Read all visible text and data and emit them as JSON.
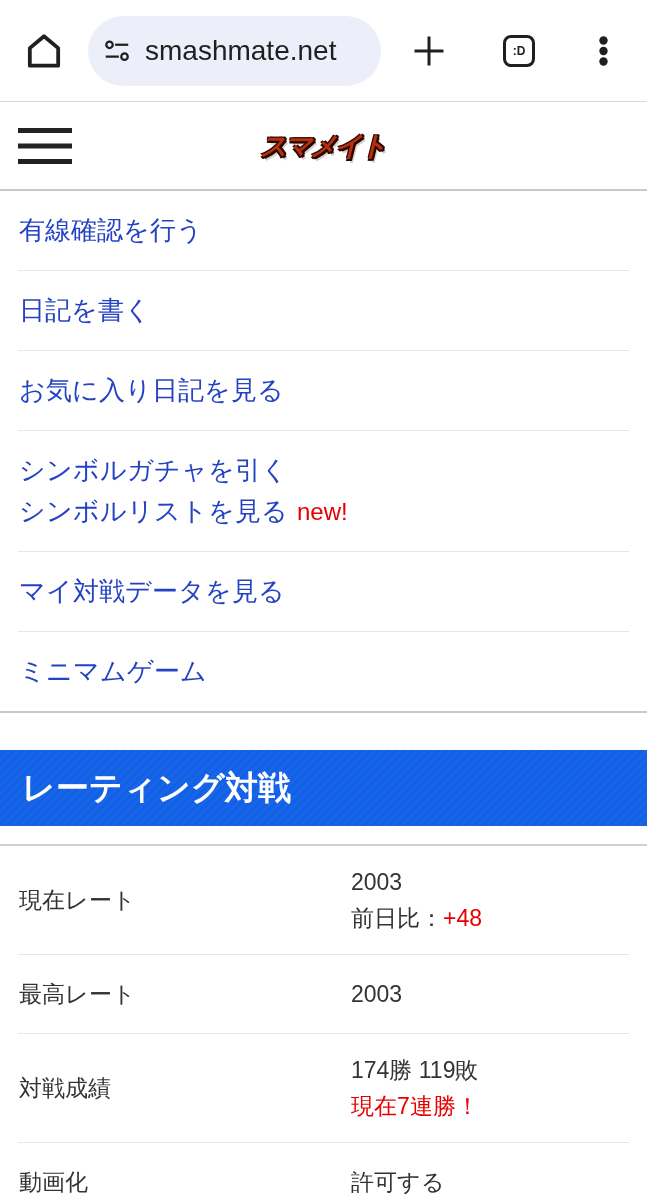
{
  "browser_bar": {
    "url": "smashmate.net",
    "tab_switcher_label": ":D"
  },
  "site_header": {
    "logo_text": "スマメイト"
  },
  "menu": [
    {
      "links": [
        {
          "label": "有線確認を行う"
        }
      ]
    },
    {
      "links": [
        {
          "label": "日記を書く"
        }
      ]
    },
    {
      "links": [
        {
          "label": "お気に入り日記を見る"
        }
      ]
    },
    {
      "links": [
        {
          "label": "シンボルガチャを引く"
        },
        {
          "label": "シンボルリストを見る",
          "badge": "new!"
        }
      ]
    },
    {
      "links": [
        {
          "label": "マイ対戦データを見る"
        }
      ]
    },
    {
      "links": [
        {
          "label": "ミニマムゲーム"
        }
      ]
    }
  ],
  "rating_section": {
    "title": "レーティング対戦",
    "rows": [
      {
        "label": "現在レート",
        "lines": [
          {
            "parts": [
              {
                "text": "2003",
                "highlight": false
              }
            ]
          },
          {
            "parts": [
              {
                "text": "前日比：",
                "highlight": false
              },
              {
                "text": "+48",
                "highlight": true
              }
            ]
          }
        ]
      },
      {
        "label": "最高レート",
        "lines": [
          {
            "parts": [
              {
                "text": "2003",
                "highlight": false
              }
            ]
          }
        ]
      },
      {
        "label": "対戦成績",
        "lines": [
          {
            "parts": [
              {
                "text": "174勝 119敗",
                "highlight": false
              }
            ]
          },
          {
            "parts": [
              {
                "text": "現在7連勝！",
                "highlight": true
              }
            ]
          }
        ]
      },
      {
        "label": "動画化",
        "lines": [
          {
            "parts": [
              {
                "text": "許可する",
                "highlight": false
              }
            ]
          }
        ]
      }
    ]
  }
}
